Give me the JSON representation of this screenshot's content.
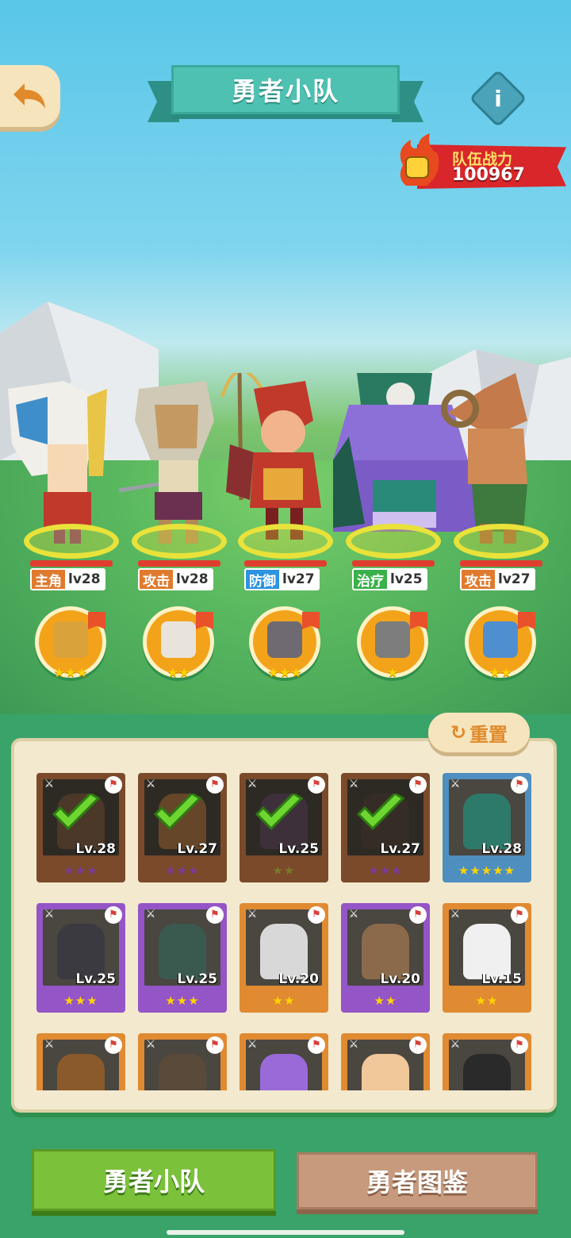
{
  "header": {
    "title": "勇者小队",
    "info_icon": "info-icon",
    "back_icon": "back-arrow-icon"
  },
  "team_power": {
    "label": "队伍战力",
    "value": "100967"
  },
  "heroes": [
    {
      "role": "主角",
      "level": "lv28",
      "role_color": "#e07a2e",
      "pet_stars": "★★★"
    },
    {
      "role": "攻击",
      "level": "lv28",
      "role_color": "#e07a2e",
      "pet_stars": "★★"
    },
    {
      "role": "防御",
      "level": "lv27",
      "role_color": "#2e93e0",
      "pet_stars": "★★★"
    },
    {
      "role": "治疗",
      "level": "lv25",
      "role_color": "#3ab14a",
      "pet_stars": "★"
    },
    {
      "role": "攻击",
      "level": "lv27",
      "role_color": "#e07a2e",
      "pet_stars": "★★"
    }
  ],
  "panel": {
    "reset_label": "重置"
  },
  "cards": [
    {
      "level": "Lv.28",
      "stars": "★★★",
      "selected": true
    },
    {
      "level": "Lv.27",
      "stars": "★★★",
      "selected": true
    },
    {
      "level": "Lv.25",
      "stars": "★★",
      "selected": true
    },
    {
      "level": "Lv.27",
      "stars": "★★★",
      "selected": true
    },
    {
      "level": "Lv.28",
      "stars": "★★★★★",
      "selected": false
    },
    {
      "level": "Lv.25",
      "stars": "★★★",
      "selected": false
    },
    {
      "level": "Lv.25",
      "stars": "★★★",
      "selected": false
    },
    {
      "level": "Lv.20",
      "stars": "★★",
      "selected": false
    },
    {
      "level": "Lv.20",
      "stars": "★★",
      "selected": false
    },
    {
      "level": "Lv.15",
      "stars": "★★",
      "selected": false
    },
    {
      "level": "",
      "stars": "",
      "selected": false
    },
    {
      "level": "",
      "stars": "",
      "selected": false
    },
    {
      "level": "",
      "stars": "",
      "selected": false
    },
    {
      "level": "",
      "stars": "",
      "selected": false
    },
    {
      "level": "",
      "stars": "",
      "selected": false
    }
  ],
  "bottom_tabs": {
    "team": "勇者小队",
    "gallery": "勇者图鉴"
  }
}
